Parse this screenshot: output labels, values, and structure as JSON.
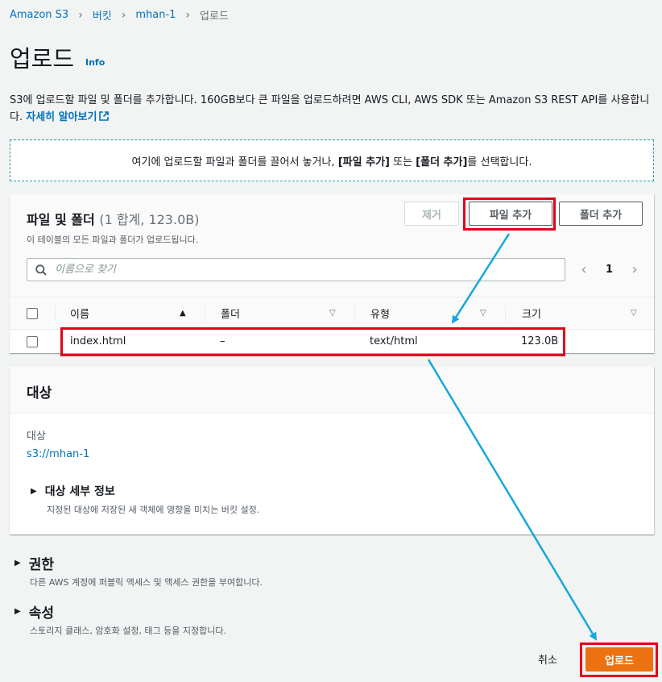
{
  "breadcrumb": {
    "items": [
      "Amazon S3",
      "버킷",
      "mhan-1"
    ],
    "current": "업로드"
  },
  "page": {
    "title": "업로드",
    "info": "Info",
    "description": "S3에 업로드할 파일 및 폴더를 추가합니다. 160GB보다 큰 파일을 업로드하려면 AWS CLI, AWS SDK 또는 Amazon S3 REST API를 사용합니다.",
    "learn_more": "자세히 알아보기"
  },
  "dropzone": {
    "text_before": "여기에 업로드할 파일과 폴더를 끌어서 놓거나,",
    "add_files": "[파일 추가]",
    "text_middle": "또는",
    "add_folder": "[폴더 추가]",
    "text_after": "를 선택합니다."
  },
  "files": {
    "title": "파일 및 폴더",
    "count": "(1 합계, 123.0B)",
    "subtitle": "이 테이블의 모든 파일과 폴더가 업로드됩니다.",
    "remove_label": "제거",
    "add_files_label": "파일 추가",
    "add_folder_label": "폴더 추가",
    "search_placeholder": "이름으로 찾기",
    "page": "1",
    "columns": [
      "이름",
      "폴더",
      "유형",
      "크기"
    ],
    "rows": [
      {
        "name": "index.html",
        "folder": "–",
        "type": "text/html",
        "size": "123.0B"
      }
    ]
  },
  "target": {
    "title": "대상",
    "label": "대상",
    "value": "s3://mhan-1",
    "details_title": "대상 세부 정보",
    "details_desc": "지정된 대상에 저장된 새 객체에 영향을 미치는 버킷 설정."
  },
  "permissions": {
    "title": "권한",
    "desc": "다른 AWS 계정에 퍼블릭 액세스 및 액세스 권한을 부여합니다."
  },
  "properties": {
    "title": "속성",
    "desc": "스토리지 클래스, 암호화 설정, 태그 등을 지정합니다."
  },
  "footer": {
    "cancel": "취소",
    "upload": "업로드"
  },
  "colors": {
    "link": "#0073bb",
    "primary": "#ec7211",
    "highlight": "#e3001b",
    "arrow": "#14a7e0"
  }
}
